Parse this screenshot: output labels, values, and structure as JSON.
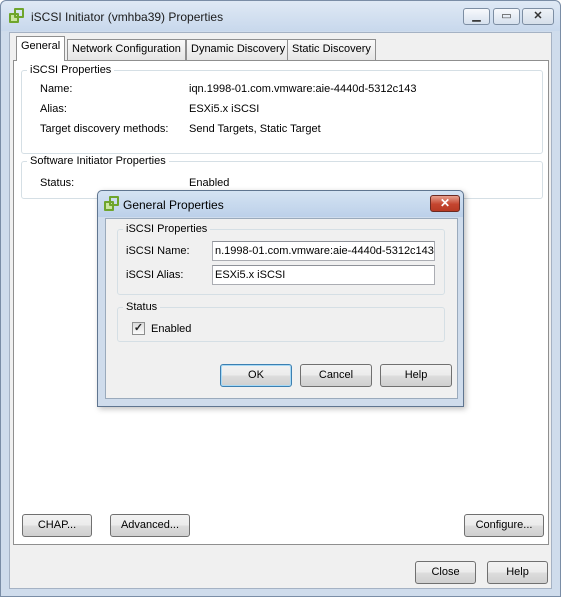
{
  "window": {
    "title": "iSCSI Initiator (vmhba39) Properties",
    "minimize_glyph": "▁",
    "maximize_glyph": "▭",
    "close_glyph": "✕",
    "icon": "vmware-app-icon"
  },
  "tabs": [
    {
      "label": "General",
      "active": true
    },
    {
      "label": "Network Configuration",
      "active": false
    },
    {
      "label": "Dynamic Discovery",
      "active": false
    },
    {
      "label": "Static Discovery",
      "active": false
    }
  ],
  "iscsi_properties": {
    "legend": "iSCSI Properties",
    "name_label": "Name:",
    "name_value": "iqn.1998-01.com.vmware:aie-4440d-5312c143",
    "alias_label": "Alias:",
    "alias_value": "ESXi5.x iSCSI",
    "discovery_label": "Target discovery methods:",
    "discovery_value": "Send Targets, Static Target"
  },
  "software_initiator": {
    "legend": "Software Initiator Properties",
    "status_label": "Status:",
    "status_value": "Enabled"
  },
  "bottom_buttons": {
    "chap": "CHAP...",
    "advanced": "Advanced...",
    "configure": "Configure...",
    "close": "Close",
    "help": "Help"
  },
  "dialog": {
    "title": "General Properties",
    "close_glyph": "✕",
    "iscsi_legend": "iSCSI Properties",
    "name_label": "iSCSI Name:",
    "name_value": "n.1998-01.com.vmware:aie-4440d-5312c143",
    "alias_label": "iSCSI Alias:",
    "alias_value": "ESXi5.x iSCSI",
    "status_legend": "Status",
    "enabled_label": "Enabled",
    "enabled_checked": true,
    "check_glyph": "✓",
    "ok": "OK",
    "cancel": "Cancel",
    "help": "Help"
  }
}
